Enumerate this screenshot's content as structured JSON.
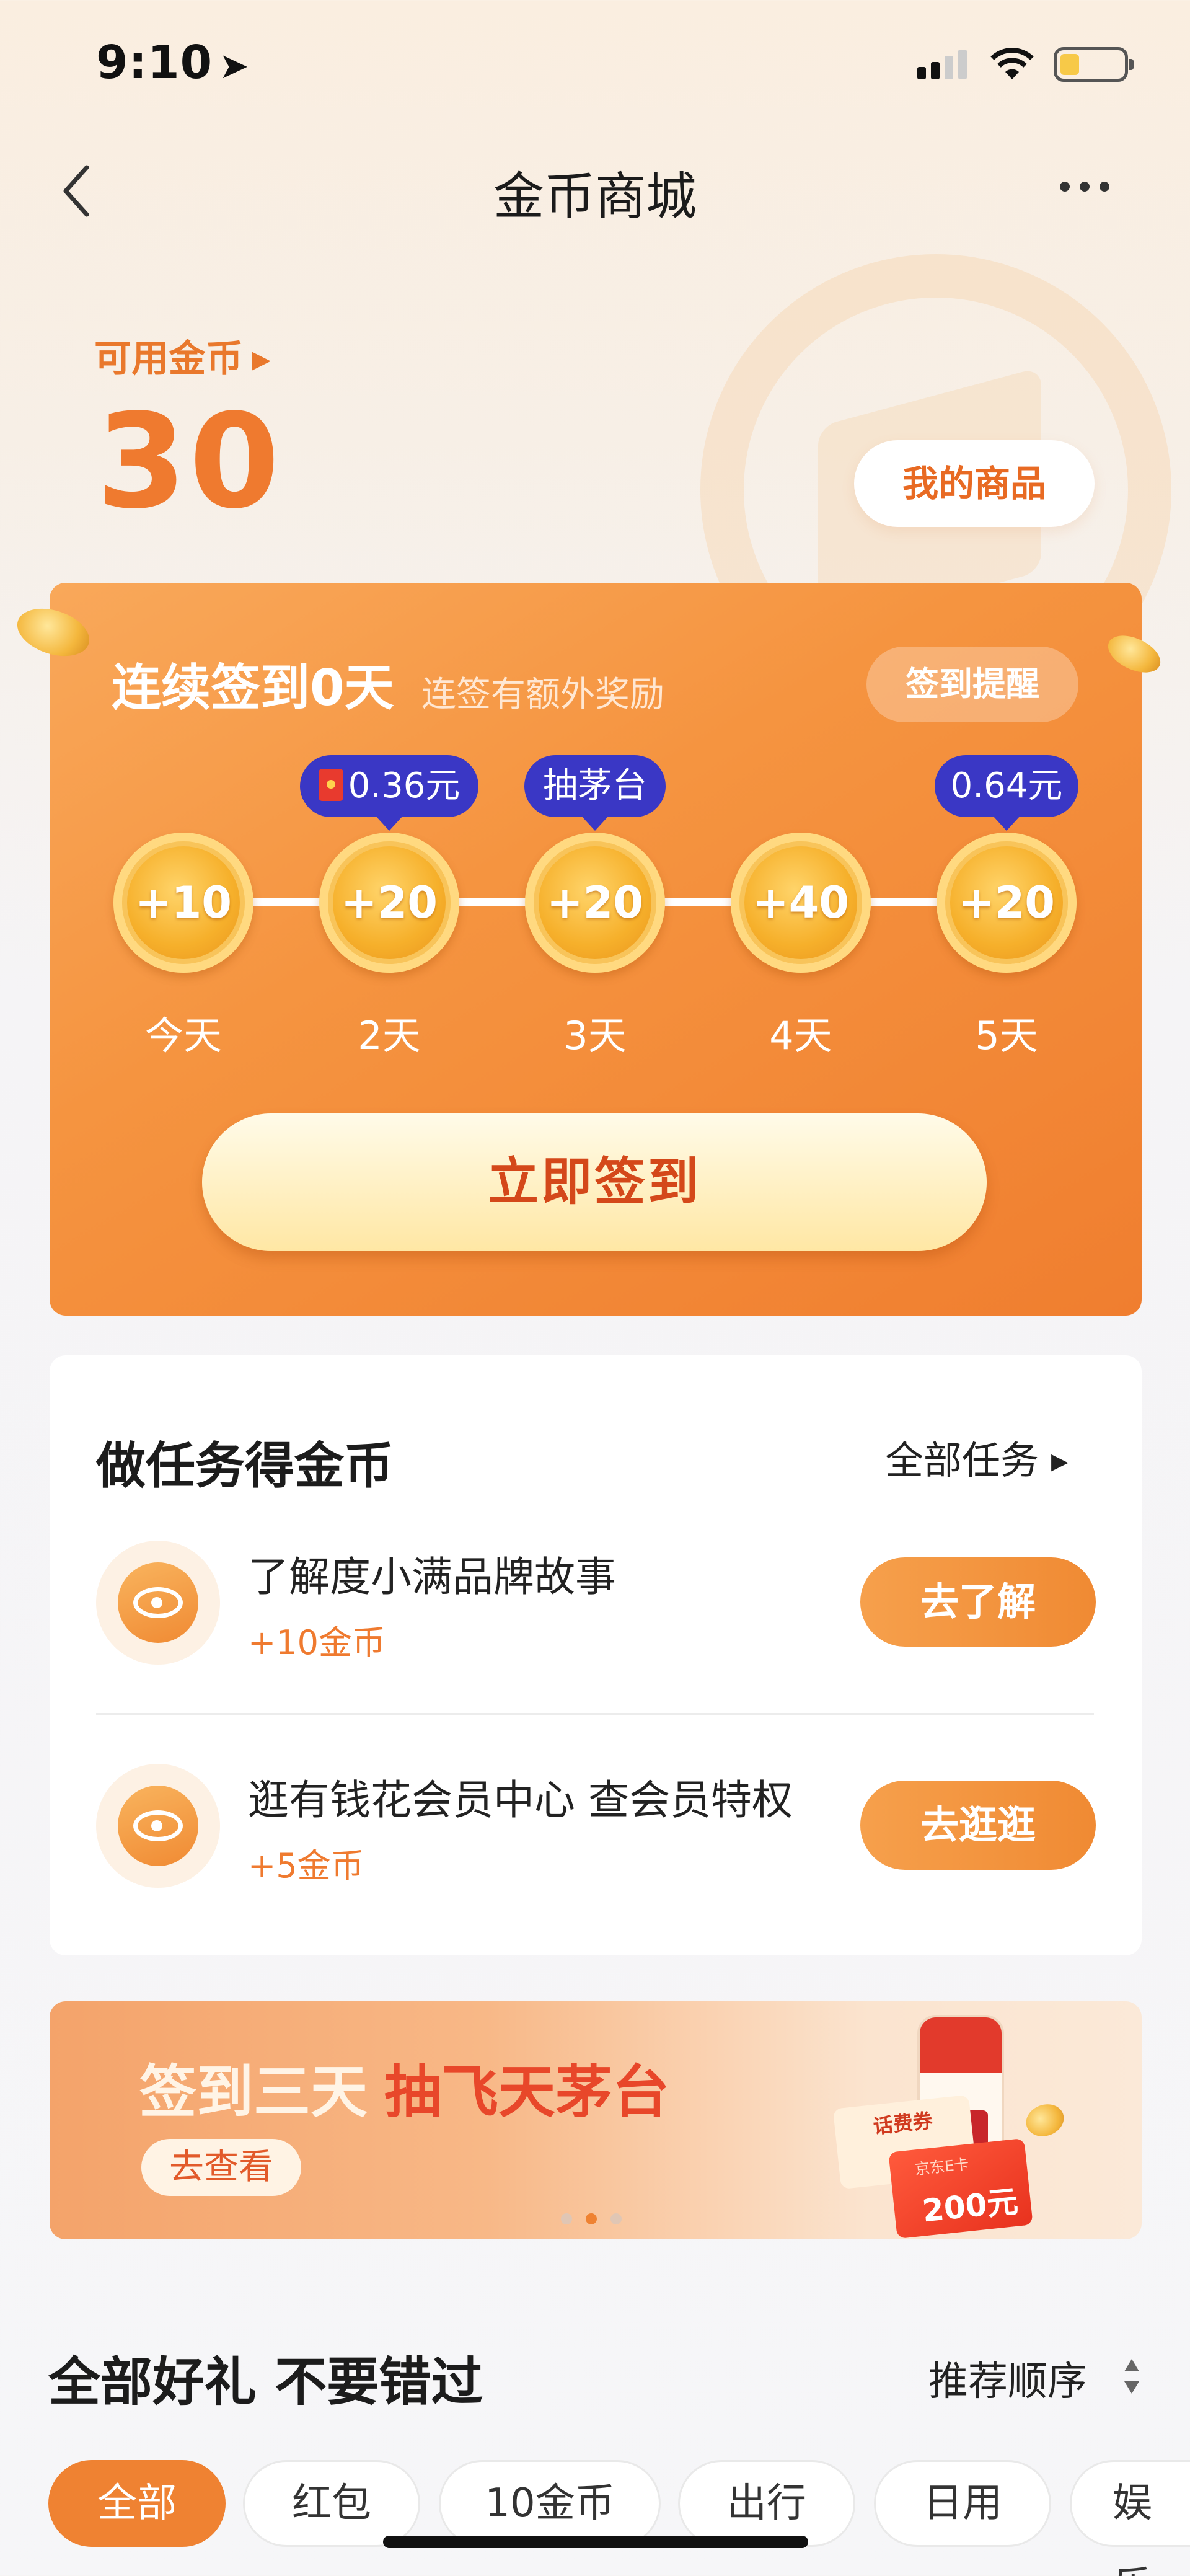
{
  "status_bar": {
    "time": "9:10"
  },
  "nav": {
    "title": "金币商城"
  },
  "hero": {
    "available_label": "可用金币",
    "balance": "30",
    "my_goods_label": "我的商品"
  },
  "checkin": {
    "title": "连续签到0天",
    "subtitle": "连签有额外奖励",
    "reminder_label": "签到提醒",
    "days": [
      {
        "reward": "+10",
        "label": "今天"
      },
      {
        "reward": "+20",
        "label": "2天",
        "bubble": "0.36元"
      },
      {
        "reward": "+20",
        "label": "3天",
        "bubble": "抽茅台"
      },
      {
        "reward": "+40",
        "label": "4天"
      },
      {
        "reward": "+20",
        "label": "5天",
        "bubble": "0.64元"
      }
    ],
    "button_label": "立即签到"
  },
  "tasks": {
    "title": "做任务得金币",
    "all_label": "全部任务",
    "items": [
      {
        "name": "了解度小满品牌故事",
        "reward": "+10金币",
        "button": "去了解"
      },
      {
        "name": "逛有钱花会员中心 查会员特权",
        "reward": "+5金币",
        "button": "去逛逛"
      }
    ]
  },
  "banner": {
    "title_part1": "签到三天",
    "title_part2": "抽飞天茅台",
    "button_label": "去查看",
    "voucher_label": "话费券",
    "giftcard_name": "京东E卡",
    "giftcard_value": "200元",
    "pages": 3,
    "active_page": 2
  },
  "gifts": {
    "title": "全部好礼 不要错过",
    "sort_label": "推荐顺序",
    "categories": [
      "全部",
      "红包",
      "10金币",
      "出行",
      "日用",
      "娱乐"
    ],
    "active_category": "全部"
  },
  "colors": {
    "accent": "#ef7a2f",
    "bubble": "#3a37c5",
    "sign_button_text": "#d4481a"
  }
}
